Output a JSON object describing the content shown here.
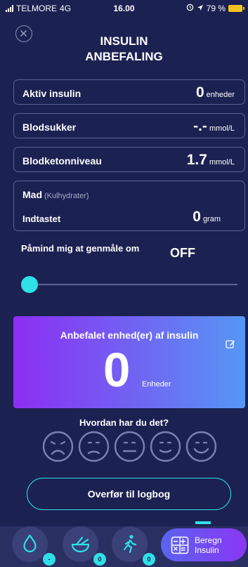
{
  "status": {
    "carrier": "TELMORE",
    "network": "4G",
    "time": "16.00",
    "battery": "79 %"
  },
  "header": {
    "title_line1": "INSULIN",
    "title_line2": "ANBEFALING"
  },
  "active_insulin": {
    "label": "Aktiv insulin",
    "value": "0",
    "unit": "enheder"
  },
  "blood_sugar": {
    "label": "Blodsukker",
    "value": "-.-",
    "unit": "mmol/L"
  },
  "ketone": {
    "label": "Blodketonniveau",
    "value": "1.7",
    "unit": "mmol/L"
  },
  "food": {
    "label": "Mad",
    "sublabel": "(Kulhydrater)",
    "entered_label": "Indtastet",
    "value": "0",
    "unit": "gram"
  },
  "reminder": {
    "label": "Påmind mig at genmåle om",
    "value": "OFF",
    "slider_level": 0
  },
  "recommendation": {
    "title": "Anbefalet enhed(er) af insulin",
    "value": "0",
    "unit": "Enheder"
  },
  "feeling": {
    "title": "Hvordan har du det?",
    "faces": [
      "very-sad-face-icon",
      "sad-face-icon",
      "neutral-face-icon",
      "content-face-icon",
      "happy-face-icon"
    ]
  },
  "transfer_button": {
    "label": "Overfør til logbog"
  },
  "bottom_nav": {
    "drop_badge": "-",
    "meal_badge": "0",
    "activity_badge": "0",
    "calc_label_line1": "Beregn",
    "calc_label_line2": "Insulin"
  },
  "colors": {
    "background": "#1b2151",
    "accent": "#2ee0e6",
    "card_gradient_start": "#8c2ef2",
    "card_gradient_end": "#5597f5"
  }
}
